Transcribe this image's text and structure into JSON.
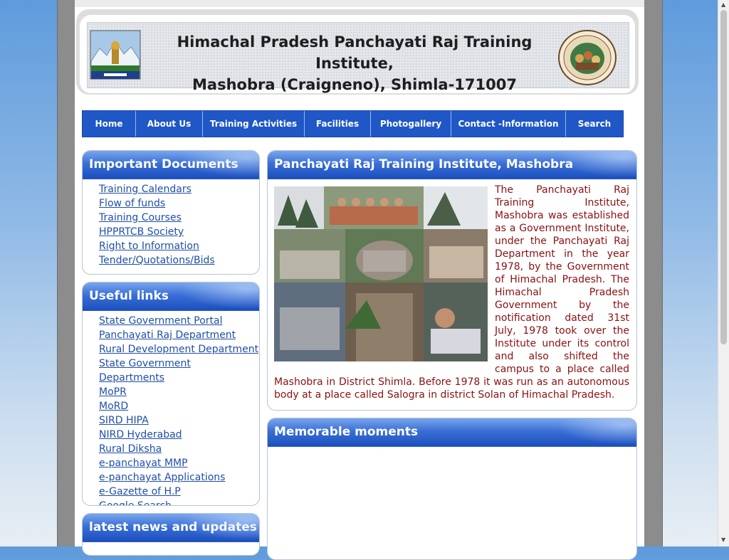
{
  "header": {
    "title_line1": "Himachal Pradesh Panchayati Raj Training Institute,",
    "title_line2": "Mashobra (Craigneno), Shimla-171007"
  },
  "nav": {
    "items": [
      "Home",
      "About Us",
      "Training Activities",
      "Facilities",
      "Photogallery",
      "Contact -Information",
      "Search"
    ]
  },
  "important_documents": {
    "title": "Important Documents",
    "links": [
      "Training Calendars",
      "Flow of funds",
      "Training Courses",
      "HPPRTCB Society",
      "Right to Information",
      "Tender/Quotations/Bids"
    ]
  },
  "useful_links": {
    "title": "Useful links",
    "links": [
      "State Government Portal",
      "Panchayati Raj Department",
      "Rural Development Department",
      "State Government Departments",
      "MoPR",
      "MoRD",
      "SIRD HIPA",
      "NIRD Hyderabad",
      "Rural Diksha",
      "e-panchayat MMP",
      "e-panchayat Applications",
      "e-Gazette of H.P",
      "Google Search"
    ]
  },
  "news": {
    "title": "latest news and updates"
  },
  "main": {
    "title": "Panchayati Raj Training Institute, Mashobra",
    "body": "The Panchayati Raj Training Institute, Mashobra was established as a Government Institute, under the Panchayati Raj Department in the year 1978, by the Government of Himachal Pradesh. The Himachal Pradesh Government by the notification dated 31st July, 1978 took over the Institute under its control and also shifted the campus to a place called Mashobra in District Shimla. Before 1978 it was run as an autonomous body at a place called Salogra in district Solan of Himachal Pradesh."
  },
  "memorable": {
    "title": "Memorable moments"
  },
  "colors": {
    "nav_bg": "#1f57c6",
    "box_head": "#2a5ec8",
    "link": "#1f4fa8",
    "article_text": "#8b1010"
  }
}
